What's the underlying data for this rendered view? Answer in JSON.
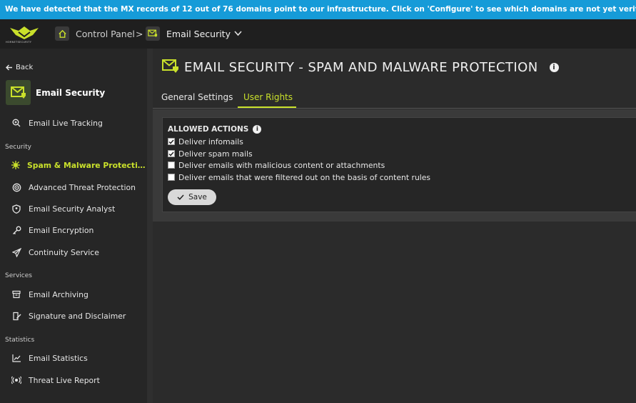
{
  "banner": {
    "text": "We have detected that the MX records of 12 out of 76 domains point to our infrastructure. Click on 'Configure' to see which domains are not yet verified."
  },
  "topbar": {
    "logo_text": "HORNETSECURITY",
    "breadcrumb": [
      {
        "label": "Control Panel",
        "icon": "home-icon"
      },
      {
        "separator": ">"
      },
      {
        "label": "Email Security",
        "icon": "email-shield-icon"
      }
    ]
  },
  "sidebar": {
    "back_label": "Back",
    "app_title": "Email Security",
    "top_items": [
      {
        "label": "Email Live Tracking",
        "icon": "zoom-search-icon"
      }
    ],
    "sections": [
      {
        "label": "Security",
        "items": [
          {
            "label": "Spam & Malware Protecti…",
            "icon": "virus-icon",
            "active": true
          },
          {
            "label": "Advanced Threat Protection",
            "icon": "target-icon"
          },
          {
            "label": "Email Security Analyst",
            "icon": "shield-icon"
          },
          {
            "label": "Email Encryption",
            "icon": "key-icon"
          },
          {
            "label": "Continuity Service",
            "icon": "paper-plane-icon"
          }
        ]
      },
      {
        "label": "Services",
        "items": [
          {
            "label": "Email Archiving",
            "icon": "archive-box-icon"
          },
          {
            "label": "Signature and Disclaimer",
            "icon": "signature-icon"
          }
        ]
      },
      {
        "label": "Statistics",
        "items": [
          {
            "label": "Email Statistics",
            "icon": "chart-line-icon"
          },
          {
            "label": "Threat Live Report",
            "icon": "live-report-icon"
          }
        ]
      }
    ]
  },
  "main": {
    "title": "EMAIL SECURITY - SPAM AND MALWARE PROTECTION",
    "tabs": [
      {
        "label": "General Settings",
        "active": false
      },
      {
        "label": "User Rights",
        "active": true
      }
    ],
    "allowed_actions": {
      "heading": "ALLOWED ACTIONS",
      "options": [
        {
          "label": "Deliver infomails",
          "checked": true
        },
        {
          "label": "Deliver spam mails",
          "checked": true
        },
        {
          "label": "Deliver emails with malicious content or attachments",
          "checked": false
        },
        {
          "label": "Deliver emails that were filtered out on the basis of content rules",
          "checked": false
        }
      ],
      "save_label": "Save"
    }
  },
  "colors": {
    "accent": "#c9e02b",
    "banner": "#169bd8",
    "sidebar_bg": "#262626",
    "main_bg": "#2b2b2b"
  }
}
